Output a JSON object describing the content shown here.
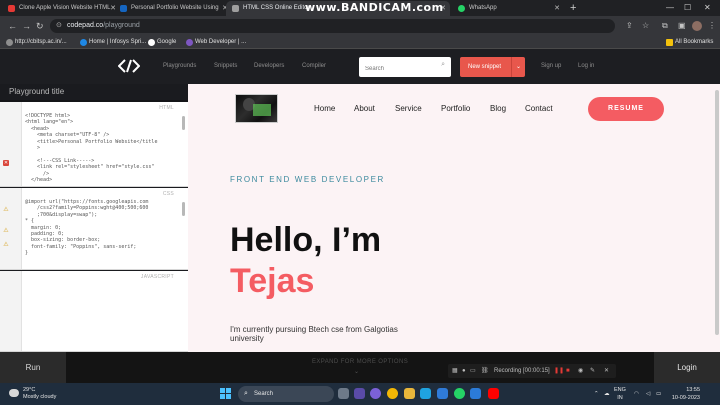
{
  "browser": {
    "tabs": [
      {
        "title": "Clone Apple Vision Website HTML",
        "favicon_color": "#e53935"
      },
      {
        "title": "Personal Portfolio Website Using",
        "favicon_color": "#1565c0"
      },
      {
        "title": "HTML CSS Online Editor",
        "favicon_color": "#9e9e9e"
      },
      {
        "title": "WhatsApp",
        "favicon_color": "#25d366"
      }
    ],
    "recorder_overlay": "www.BANDICAM.com",
    "url_host": "codepad.co",
    "url_path": "/playground",
    "bookmarks": [
      {
        "label": "http://cbitsp.ac.in/...",
        "color": "#8e8e8e"
      },
      {
        "label": "Home | Infosys Spri...",
        "color": "#1e88e5"
      },
      {
        "label": "Google",
        "color": "#ffffff"
      },
      {
        "label": "Web Developer | ...",
        "color": "#7e57c2"
      }
    ],
    "all_bookmarks": "All Bookmarks"
  },
  "codepad": {
    "nav": [
      "Playgrounds",
      "Snippets",
      "Developers",
      "Compiler"
    ],
    "search_placeholder": "Search",
    "new_snippet": "New snippet",
    "signup": "Sign up",
    "login": "Log in"
  },
  "editor": {
    "title": "Playground title",
    "html_label": "HTML",
    "css_label": "CSS",
    "js_label": "JAVASCRIPT",
    "html_code": "<!DOCTYPE html>\n<html lang=\"en\">\n  <head>\n    <meta charset=\"UTF-8\" />\n    <title>Personal Portfolio Website</title\n    >\n\n    <!---CSS Link----->\n    <link rel=\"stylesheet\" href=\"style.css\"\n      />\n  </head>",
    "css_code": "@import url(\"https://fonts.googleapis.com\n    /css2?family=Poppins:wght@400;500;600\n    ;700&display=swap\");\n* {\n  margin: 0;\n  padding: 0;\n  box-sizing: border-box;\n  font-family: \"Poppins\", sans-serif;\n}",
    "js_code": ""
  },
  "preview": {
    "nav": [
      "Home",
      "About",
      "Service",
      "Portfolio",
      "Blog",
      "Contact"
    ],
    "resume": "RESUME",
    "subtitle": "FRONT END WEB DEVELOPER",
    "hello": "Hello, I’m",
    "name": "Tejas",
    "paragraph": "I'm currently pursuing Btech cse from Galgotias university",
    "accent": "#f45c62",
    "subtitle_color": "#3c8a9e"
  },
  "bottom": {
    "run": "Run",
    "expand": "EXPAND FOR MORE OPTIONS",
    "login": "Login",
    "recording": "Recording [00:00:15]"
  },
  "taskbar": {
    "temp": "29°C",
    "weather": "Mostly cloudy",
    "search": "Search",
    "lang1": "ENG",
    "lang2": "IN",
    "time": "13:55",
    "date": "10-09-2023"
  }
}
